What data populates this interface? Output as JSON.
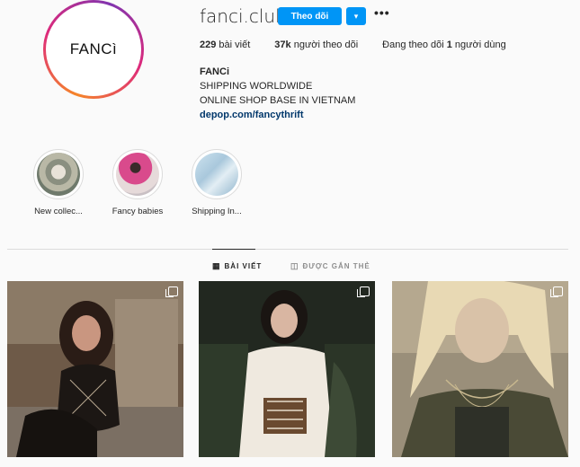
{
  "profile": {
    "avatar_text": "FANCì",
    "username": "fanci.club",
    "follow_label": "Theo dõi",
    "dropdown_icon": "▾",
    "more_icon": "•••"
  },
  "stats": {
    "posts_count": "229",
    "posts_label": "bài viết",
    "followers_count": "37k",
    "followers_label": "người theo dõi",
    "following_prefix": "Đang theo dõi",
    "following_count": "1",
    "following_suffix": "người dùng"
  },
  "bio": {
    "name": "FANCi",
    "line1": "SHIPPING WORLDWIDE",
    "line2": "ONLINE SHOP BASE IN VIETNAM",
    "link": "depop.com/fancythrift"
  },
  "highlights": [
    {
      "label": "New collec..."
    },
    {
      "label": "Fancy babies"
    },
    {
      "label": "Shipping In..."
    }
  ],
  "tabs": {
    "posts_icon": "▦",
    "posts_label": "BÀI VIẾT",
    "tagged_icon": "◫",
    "tagged_label": "ĐƯỢC GẮN THẺ"
  }
}
